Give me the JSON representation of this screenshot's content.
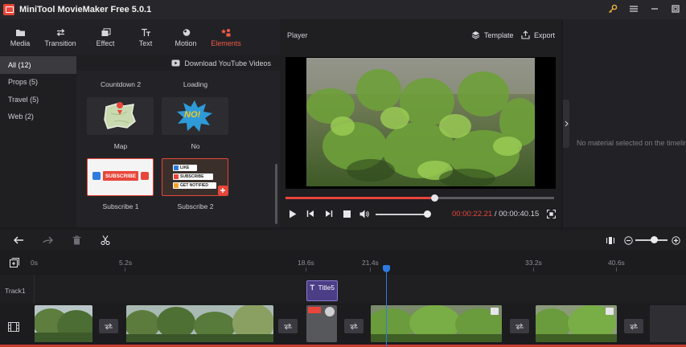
{
  "app": {
    "title": "MiniTool MovieMaker Free 5.0.1"
  },
  "toolbar": {
    "items": [
      {
        "label": "Media",
        "icon": "media-icon"
      },
      {
        "label": "Transition",
        "icon": "transition-icon"
      },
      {
        "label": "Effect",
        "icon": "effect-icon"
      },
      {
        "label": "Text",
        "icon": "text-icon"
      },
      {
        "label": "Motion",
        "icon": "motion-icon"
      },
      {
        "label": "Elements",
        "icon": "elements-icon",
        "active": true
      }
    ]
  },
  "sidebar": {
    "items": [
      {
        "label": "All (12)",
        "active": true
      },
      {
        "label": "Props (5)"
      },
      {
        "label": "Travel (5)"
      },
      {
        "label": "Web (2)"
      }
    ]
  },
  "library": {
    "download_label": "Download YouTube Videos",
    "items": [
      {
        "label": "Countdown 2"
      },
      {
        "label": "Loading"
      },
      {
        "label": "Map"
      },
      {
        "label": "No",
        "art_text": "NO!"
      },
      {
        "label": "Subscribe 1",
        "art_text": "SUBSCRIBE"
      },
      {
        "label": "Subscribe 2",
        "art_lines": [
          "LIKE",
          "SUBSCRIBE",
          "GET NOTIFIED"
        ]
      }
    ]
  },
  "player": {
    "title": "Player",
    "template_label": "Template",
    "export_label": "Export",
    "progress": 0.5534,
    "volume": 0.95,
    "current_time": "00:00:22.21",
    "separator": " / ",
    "total_time": "00:00:40.15"
  },
  "properties": {
    "empty_message": "No material selected on the timeline"
  },
  "timeline": {
    "ruler": [
      "0s",
      "5.2s",
      "18.6s",
      "21.4s",
      "33.2s",
      "40.6s"
    ],
    "tracks": [
      {
        "label": "Track1",
        "clips": [
          {
            "label": "Title5",
            "type": "text"
          }
        ]
      }
    ],
    "zoom": 0.55
  },
  "colors": {
    "accent": "#e8463a",
    "playhead": "#2f7ae0",
    "background": "#1b1b1e",
    "panel": "#222226"
  }
}
